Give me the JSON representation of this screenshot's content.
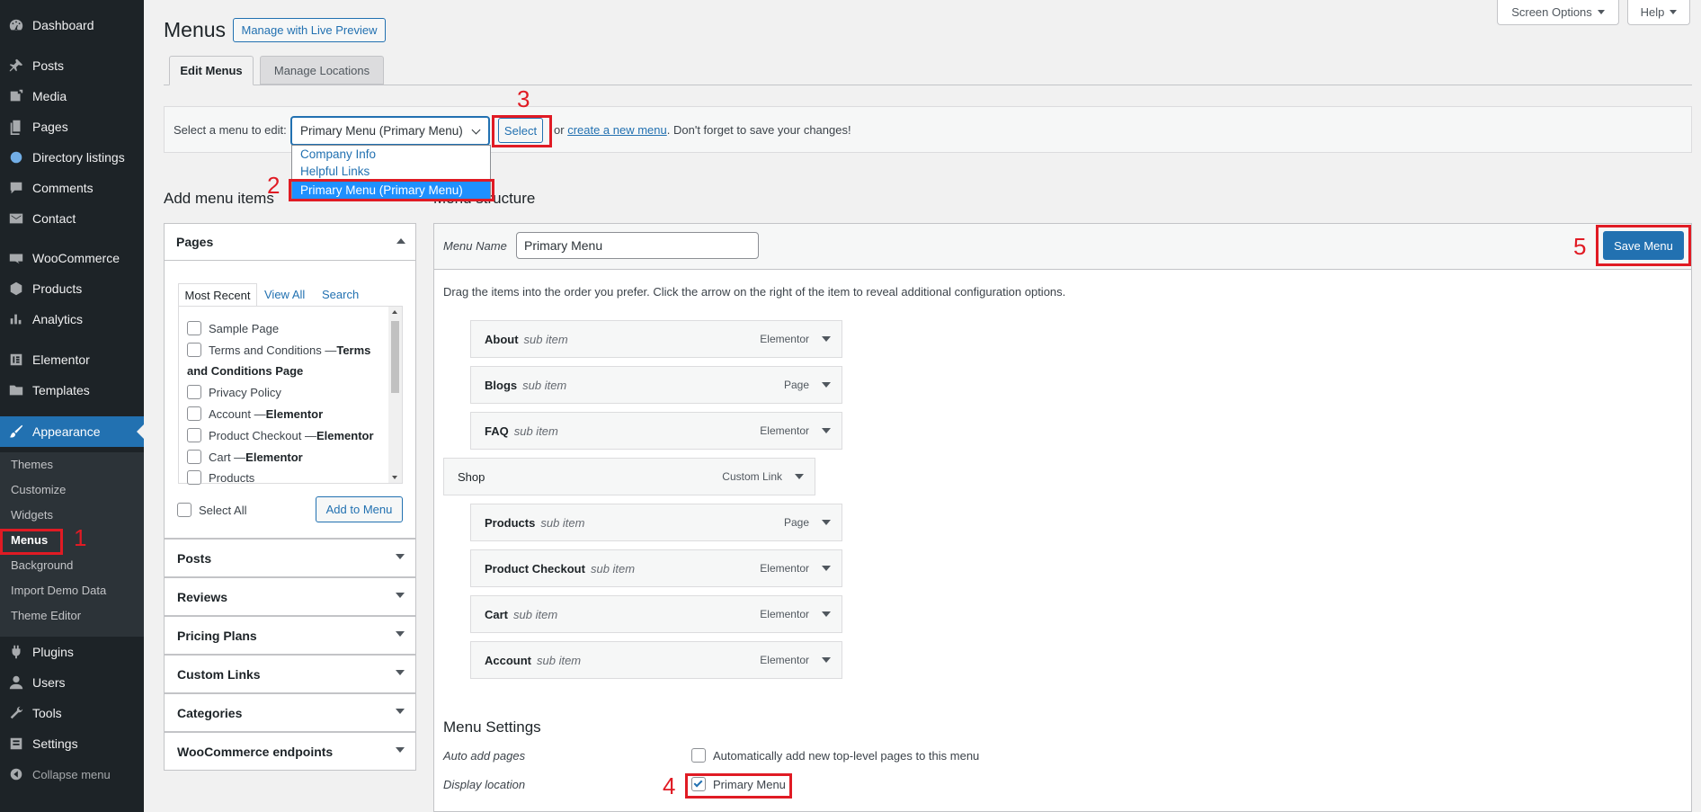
{
  "sidebar": {
    "items": [
      {
        "label": "Dashboard",
        "icon": "dashboard-icon"
      },
      {
        "label": "Posts",
        "icon": "pin-icon"
      },
      {
        "label": "Media",
        "icon": "media-icon"
      },
      {
        "label": "Pages",
        "icon": "pages-icon"
      },
      {
        "label": "Directory listings",
        "icon": "globe-icon"
      },
      {
        "label": "Comments",
        "icon": "comment-icon"
      },
      {
        "label": "Contact",
        "icon": "mail-icon"
      },
      {
        "label": "WooCommerce",
        "icon": "woo-icon"
      },
      {
        "label": "Products",
        "icon": "box-icon"
      },
      {
        "label": "Analytics",
        "icon": "chart-bar-icon"
      },
      {
        "label": "Elementor",
        "icon": "elementor-icon"
      },
      {
        "label": "Templates",
        "icon": "folder-icon"
      },
      {
        "label": "Appearance",
        "icon": "brush-icon"
      },
      {
        "label": "Plugins",
        "icon": "plug-icon"
      },
      {
        "label": "Users",
        "icon": "user-icon"
      },
      {
        "label": "Tools",
        "icon": "wrench-icon"
      },
      {
        "label": "Settings",
        "icon": "settings-icon"
      },
      {
        "label": "Collapse menu",
        "icon": "collapse-icon"
      }
    ],
    "submenu": [
      "Themes",
      "Customize",
      "Widgets",
      "Menus",
      "Background",
      "Import Demo Data",
      "Theme Editor"
    ]
  },
  "header": {
    "title": "Menus",
    "live_preview": "Manage with Live Preview",
    "screen_options": "Screen Options",
    "help": "Help",
    "tabs": [
      "Edit Menus",
      "Manage Locations"
    ]
  },
  "select_bar": {
    "label": "Select a menu to edit:",
    "selected": "Primary Menu (Primary Menu)",
    "button": "Select",
    "or_text": "or",
    "create_link": "create a new menu",
    "reminder": ". Don't forget to save your changes!"
  },
  "dropdown": {
    "options": [
      "Company Info",
      "Helpful Links",
      "Primary Menu (Primary Menu)"
    ]
  },
  "add_items": {
    "heading": "Add menu items",
    "pages_heading": "Pages",
    "tabs": [
      "Most Recent",
      "View All",
      "Search"
    ],
    "pages": [
      {
        "label": "Sample Page",
        "suffix": ""
      },
      {
        "label": "Terms and Conditions — ",
        "suffix": "Terms"
      },
      {
        "label": "",
        "suffix": "and Conditions Page"
      },
      {
        "label": "Privacy Policy",
        "suffix": ""
      },
      {
        "label": "Account — ",
        "suffix": "Elementor"
      },
      {
        "label": "Product Checkout — ",
        "suffix": "Elementor"
      },
      {
        "label": "Cart — ",
        "suffix": "Elementor"
      },
      {
        "label": "Products",
        "suffix": ""
      }
    ],
    "select_all": "Select All",
    "add_button": "Add to Menu",
    "sections": [
      "Posts",
      "Reviews",
      "Pricing Plans",
      "Custom Links",
      "Categories",
      "WooCommerce endpoints"
    ]
  },
  "structure": {
    "heading": "Menu structure",
    "menu_name_label": "Menu Name",
    "menu_name_value": "Primary Menu",
    "save_button": "Save Menu",
    "instructions": "Drag the items into the order you prefer. Click the arrow on the right of the item to reveal additional configuration options.",
    "items": [
      {
        "title": "About",
        "sub": "sub item",
        "type": "Elementor",
        "depth": 1
      },
      {
        "title": "Blogs",
        "sub": "sub item",
        "type": "Page",
        "depth": 1
      },
      {
        "title": "FAQ",
        "sub": "sub item",
        "type": "Elementor",
        "depth": 1
      },
      {
        "title": "Shop",
        "sub": "",
        "type": "Custom Link",
        "depth": 0
      },
      {
        "title": "Products",
        "sub": "sub item",
        "type": "Page",
        "depth": 1
      },
      {
        "title": "Product Checkout",
        "sub": "sub item",
        "type": "Elementor",
        "depth": 1
      },
      {
        "title": "Cart",
        "sub": "sub item",
        "type": "Elementor",
        "depth": 1
      },
      {
        "title": "Account",
        "sub": "sub item",
        "type": "Elementor",
        "depth": 1
      }
    ]
  },
  "settings": {
    "heading": "Menu Settings",
    "auto_add_label": "Auto add pages",
    "auto_add_text": "Automatically add new top-level pages to this menu",
    "display_label": "Display location",
    "display_text": "Primary Menu"
  },
  "annotations": [
    "1",
    "2",
    "3",
    "4",
    "5"
  ],
  "colors": {
    "accent": "#2271b1",
    "annotation": "#e01b24",
    "sidebar": "#1d2327"
  }
}
